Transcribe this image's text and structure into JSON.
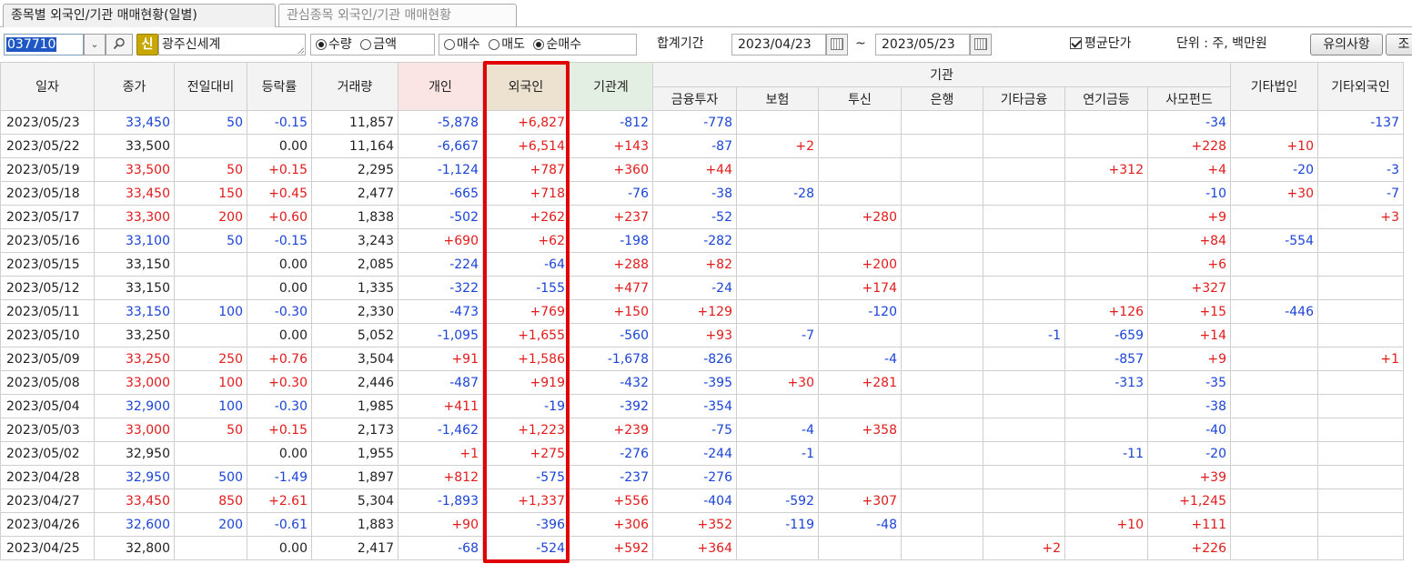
{
  "tabs": [
    {
      "label": "종목별 외국인/기관 매매현황(일별)",
      "active": true
    },
    {
      "label": "관심종목 외국인/기관 매매현황",
      "active": false
    }
  ],
  "toolbar": {
    "stock_code": "037710",
    "market_badge": "신",
    "stock_name": "광주신세계",
    "unit_options": [
      {
        "label": "수량",
        "selected": true
      },
      {
        "label": "금액",
        "selected": false
      }
    ],
    "trade_options": [
      {
        "label": "매수",
        "selected": false
      },
      {
        "label": "매도",
        "selected": false
      },
      {
        "label": "순매수",
        "selected": true
      }
    ],
    "period_label": "합계기간",
    "start_date": "2023/04/23",
    "date_separator": "~",
    "end_date": "2023/05/23",
    "avg_price_label": "평균단가",
    "avg_price_checked": true,
    "unit_text": "단위 : 주, 백만원",
    "notice_button": "유의사항",
    "query_button": "조"
  },
  "columns": {
    "date": "일자",
    "close": "종가",
    "change": "전일대비",
    "rate": "등락률",
    "volume": "거래량",
    "individual": "개인",
    "foreigner": "외국인",
    "inst_total": "기관계",
    "inst_group": "기관",
    "inst_sub": [
      "금융투자",
      "보험",
      "투신",
      "은행",
      "기타금융",
      "연기금등",
      "사모펀드"
    ],
    "other_corp": "기타법인",
    "other_foreign": "기타외국인"
  },
  "accent_colors": {
    "up": "#e21b1b",
    "down": "#1b44d8",
    "highlight": "#e10000"
  },
  "rows": [
    {
      "date": "2023/05/23",
      "close": "33,450",
      "change": "50",
      "rate": "-0.15",
      "volume": "11,857",
      "ind": "-5,878",
      "for": "+6,827",
      "inst": "-812",
      "fin": "-778",
      "ins": "",
      "trust": "",
      "bank": "",
      "ofin": "",
      "pens": "",
      "pef": "-34",
      "corp": "",
      "ofor": "-137",
      "dir": "down"
    },
    {
      "date": "2023/05/22",
      "close": "33,500",
      "change": "",
      "rate": "0.00",
      "volume": "11,164",
      "ind": "-6,667",
      "for": "+6,514",
      "inst": "+143",
      "fin": "-87",
      "ins": "+2",
      "trust": "",
      "bank": "",
      "ofin": "",
      "pens": "",
      "pef": "+228",
      "corp": "+10",
      "ofor": "",
      "dir": "flat"
    },
    {
      "date": "2023/05/19",
      "close": "33,500",
      "change": "50",
      "rate": "+0.15",
      "volume": "2,295",
      "ind": "-1,124",
      "for": "+787",
      "inst": "+360",
      "fin": "+44",
      "ins": "",
      "trust": "",
      "bank": "",
      "ofin": "",
      "pens": "+312",
      "pef": "+4",
      "corp": "-20",
      "ofor": "-3",
      "dir": "up"
    },
    {
      "date": "2023/05/18",
      "close": "33,450",
      "change": "150",
      "rate": "+0.45",
      "volume": "2,477",
      "ind": "-665",
      "for": "+718",
      "inst": "-76",
      "fin": "-38",
      "ins": "-28",
      "trust": "",
      "bank": "",
      "ofin": "",
      "pens": "",
      "pef": "-10",
      "corp": "+30",
      "ofor": "-7",
      "dir": "up"
    },
    {
      "date": "2023/05/17",
      "close": "33,300",
      "change": "200",
      "rate": "+0.60",
      "volume": "1,838",
      "ind": "-502",
      "for": "+262",
      "inst": "+237",
      "fin": "-52",
      "ins": "",
      "trust": "+280",
      "bank": "",
      "ofin": "",
      "pens": "",
      "pef": "+9",
      "corp": "",
      "ofor": "+3",
      "dir": "up"
    },
    {
      "date": "2023/05/16",
      "close": "33,100",
      "change": "50",
      "rate": "-0.15",
      "volume": "3,243",
      "ind": "+690",
      "for": "+62",
      "inst": "-198",
      "fin": "-282",
      "ins": "",
      "trust": "",
      "bank": "",
      "ofin": "",
      "pens": "",
      "pef": "+84",
      "corp": "-554",
      "ofor": "",
      "dir": "down"
    },
    {
      "date": "2023/05/15",
      "close": "33,150",
      "change": "",
      "rate": "0.00",
      "volume": "2,085",
      "ind": "-224",
      "for": "-64",
      "inst": "+288",
      "fin": "+82",
      "ins": "",
      "trust": "+200",
      "bank": "",
      "ofin": "",
      "pens": "",
      "pef": "+6",
      "corp": "",
      "ofor": "",
      "dir": "flat"
    },
    {
      "date": "2023/05/12",
      "close": "33,150",
      "change": "",
      "rate": "0.00",
      "volume": "1,335",
      "ind": "-322",
      "for": "-155",
      "inst": "+477",
      "fin": "-24",
      "ins": "",
      "trust": "+174",
      "bank": "",
      "ofin": "",
      "pens": "",
      "pef": "+327",
      "corp": "",
      "ofor": "",
      "dir": "flat"
    },
    {
      "date": "2023/05/11",
      "close": "33,150",
      "change": "100",
      "rate": "-0.30",
      "volume": "2,330",
      "ind": "-473",
      "for": "+769",
      "inst": "+150",
      "fin": "+129",
      "ins": "",
      "trust": "-120",
      "bank": "",
      "ofin": "",
      "pens": "+126",
      "pef": "+15",
      "corp": "-446",
      "ofor": "",
      "dir": "down"
    },
    {
      "date": "2023/05/10",
      "close": "33,250",
      "change": "",
      "rate": "0.00",
      "volume": "5,052",
      "ind": "-1,095",
      "for": "+1,655",
      "inst": "-560",
      "fin": "+93",
      "ins": "-7",
      "trust": "",
      "bank": "",
      "ofin": "-1",
      "pens": "-659",
      "pef": "+14",
      "corp": "",
      "ofor": "",
      "dir": "flat"
    },
    {
      "date": "2023/05/09",
      "close": "33,250",
      "change": "250",
      "rate": "+0.76",
      "volume": "3,504",
      "ind": "+91",
      "for": "+1,586",
      "inst": "-1,678",
      "fin": "-826",
      "ins": "",
      "trust": "-4",
      "bank": "",
      "ofin": "",
      "pens": "-857",
      "pef": "+9",
      "corp": "",
      "ofor": "+1",
      "dir": "up"
    },
    {
      "date": "2023/05/08",
      "close": "33,000",
      "change": "100",
      "rate": "+0.30",
      "volume": "2,446",
      "ind": "-487",
      "for": "+919",
      "inst": "-432",
      "fin": "-395",
      "ins": "+30",
      "trust": "+281",
      "bank": "",
      "ofin": "",
      "pens": "-313",
      "pef": "-35",
      "corp": "",
      "ofor": "",
      "dir": "up"
    },
    {
      "date": "2023/05/04",
      "close": "32,900",
      "change": "100",
      "rate": "-0.30",
      "volume": "1,985",
      "ind": "+411",
      "for": "-19",
      "inst": "-392",
      "fin": "-354",
      "ins": "",
      "trust": "",
      "bank": "",
      "ofin": "",
      "pens": "",
      "pef": "-38",
      "corp": "",
      "ofor": "",
      "dir": "down"
    },
    {
      "date": "2023/05/03",
      "close": "33,000",
      "change": "50",
      "rate": "+0.15",
      "volume": "2,173",
      "ind": "-1,462",
      "for": "+1,223",
      "inst": "+239",
      "fin": "-75",
      "ins": "-4",
      "trust": "+358",
      "bank": "",
      "ofin": "",
      "pens": "",
      "pef": "-40",
      "corp": "",
      "ofor": "",
      "dir": "up"
    },
    {
      "date": "2023/05/02",
      "close": "32,950",
      "change": "",
      "rate": "0.00",
      "volume": "1,955",
      "ind": "+1",
      "for": "+275",
      "inst": "-276",
      "fin": "-244",
      "ins": "-1",
      "trust": "",
      "bank": "",
      "ofin": "",
      "pens": "-11",
      "pef": "-20",
      "corp": "",
      "ofor": "",
      "dir": "flat"
    },
    {
      "date": "2023/04/28",
      "close": "32,950",
      "change": "500",
      "rate": "-1.49",
      "volume": "1,897",
      "ind": "+812",
      "for": "-575",
      "inst": "-237",
      "fin": "-276",
      "ins": "",
      "trust": "",
      "bank": "",
      "ofin": "",
      "pens": "",
      "pef": "+39",
      "corp": "",
      "ofor": "",
      "dir": "down"
    },
    {
      "date": "2023/04/27",
      "close": "33,450",
      "change": "850",
      "rate": "+2.61",
      "volume": "5,304",
      "ind": "-1,893",
      "for": "+1,337",
      "inst": "+556",
      "fin": "-404",
      "ins": "-592",
      "trust": "+307",
      "bank": "",
      "ofin": "",
      "pens": "",
      "pef": "+1,245",
      "corp": "",
      "ofor": "",
      "dir": "up"
    },
    {
      "date": "2023/04/26",
      "close": "32,600",
      "change": "200",
      "rate": "-0.61",
      "volume": "1,883",
      "ind": "+90",
      "for": "-396",
      "inst": "+306",
      "fin": "+352",
      "ins": "-119",
      "trust": "-48",
      "bank": "",
      "ofin": "",
      "pens": "+10",
      "pef": "+111",
      "corp": "",
      "ofor": "",
      "dir": "down"
    },
    {
      "date": "2023/04/25",
      "close": "32,800",
      "change": "",
      "rate": "0.00",
      "volume": "2,417",
      "ind": "-68",
      "for": "-524",
      "inst": "+592",
      "fin": "+364",
      "ins": "",
      "trust": "",
      "bank": "",
      "ofin": "+2",
      "pens": "",
      "pef": "+226",
      "corp": "",
      "ofor": "",
      "dir": "flat"
    }
  ]
}
